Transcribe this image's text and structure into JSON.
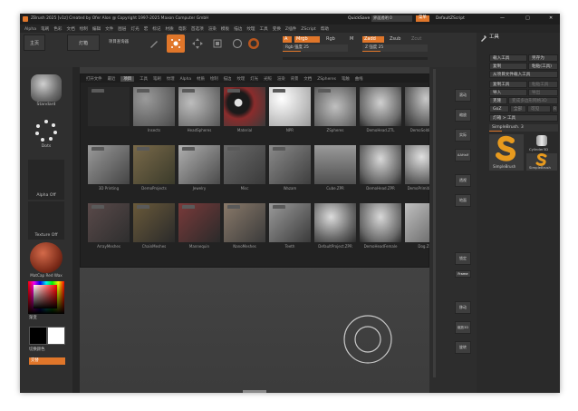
{
  "window": {
    "title": "ZBrush 2025 [v1z] Created by Ofer Alon @ Copyright 1997-2025 Maxon Computer GmbH",
    "autosave": "QuickSave",
    "transparency": "界面透明 0",
    "menus_label": "菜单",
    "script": "DefaultZScript",
    "win_controls": [
      "—",
      "□",
      "✕"
    ]
  },
  "menubar": {
    "items": [
      "Alpha",
      "笔刷",
      "色彩",
      "文档",
      "绘制",
      "编辑",
      "文件",
      "图层",
      "灯光",
      "宏",
      "标记",
      "材质",
      "电影",
      "首选项",
      "渲染",
      "模板",
      "描边",
      "纹理",
      "工具",
      "变换",
      "Z插件",
      "ZScript",
      "帮助"
    ]
  },
  "toolbar": {
    "home": "主页",
    "lightbox": "灯箱",
    "project_menu": "项目查询器",
    "tools": [
      {
        "name": "edit",
        "label": "Edit"
      },
      {
        "name": "draw",
        "label": "Draw"
      },
      {
        "name": "move",
        "label": "Move"
      },
      {
        "name": "scale",
        "label": "Scale"
      },
      {
        "name": "rotate",
        "label": "Rotate"
      }
    ],
    "a_label": "A",
    "mrgb": "Mrgb",
    "rgb": "Rgb",
    "m": "M",
    "zadd": "Zadd",
    "zsub": "Zsub",
    "zcut": "Zcut",
    "rgb_intensity": "Rgb 强度 25",
    "z_intensity": "Z 强度 25"
  },
  "left_shelf": {
    "brush": "Standard",
    "stroke": "Dots",
    "alpha": "Alpha Off",
    "texture": "Texture Off",
    "material": "MatCap Red Wax",
    "gradient": "渐变",
    "switch_color": "切换颜色",
    "alternate": "交替"
  },
  "lightbox": {
    "tabs": [
      "打开文件",
      "最近",
      "项目",
      "工具",
      "笔刷",
      "纹理",
      "Alpha",
      "材质",
      "绘制",
      "描边",
      "纹理",
      "灯光",
      "光照",
      "渲染",
      "背景",
      "文档",
      "ZSpheres",
      "笔触",
      "曲线"
    ],
    "active_tab": 2,
    "tiles": [
      {
        "label": ""
      },
      {
        "label": "Insects"
      },
      {
        "label": "HeadSpheres"
      },
      {
        "label": "Material"
      },
      {
        "label": "NPR"
      },
      {
        "label": "ZSpheres"
      },
      {
        "label": "DemoHead.ZTL"
      },
      {
        "label": "DemoSoldier.ZPR"
      },
      {
        "label": "3D Printing"
      },
      {
        "label": "DemoProjects"
      },
      {
        "label": "Jewelry"
      },
      {
        "label": "Misc"
      },
      {
        "label": "Wazam"
      },
      {
        "label": "Cube.ZPR"
      },
      {
        "label": "DemoHead.ZPR"
      },
      {
        "label": "DemoPrimitives.ZPR"
      },
      {
        "label": "ArrayMeshes"
      },
      {
        "label": "ChainMeshes"
      },
      {
        "label": "Mannequin"
      },
      {
        "label": "NanoMeshes"
      },
      {
        "label": "Teeth"
      },
      {
        "label": "DefaultProject.ZPR"
      },
      {
        "label": "DemoHeadFemale"
      },
      {
        "label": "Dog.ZPR"
      }
    ]
  },
  "right_shelf": {
    "scroll_label": "滚动",
    "zoom_label": "缩放",
    "actual_label": "实际",
    "aahalf_label": "AAHalf",
    "persp_label": "透视",
    "floor_label": "地面",
    "lock_label": "锁定",
    "frame_label": "Frame",
    "move_label": "移动",
    "zoom3d_label": "缩放3D",
    "rotate_label": "旋转"
  },
  "tool_palette": {
    "title": "工具",
    "load_tool": "载入工具",
    "save_as": "另存为",
    "copy": "复制",
    "paste": "粘贴(工具)",
    "import_from_project": "从项目文件载入工具",
    "copy_tool": "复制工具",
    "paste_tool": "粘贴工具",
    "import": "导入",
    "export": "导出",
    "clone": "克隆",
    "make_polymesh": "变成多边形网格3D",
    "goz": "GoZ",
    "all": "全部",
    "visible": "可见",
    "r": "R",
    "lightbox_tools": "灯箱 > 工具",
    "current_tool": "SimpleBrush. 3",
    "tools": [
      {
        "name": "SimpleBrush"
      },
      {
        "name": "Cylinder3D"
      },
      {
        "name": "SimpleBrush"
      }
    ]
  },
  "colors": {
    "accent": "#e0762a",
    "panel": "#2b2b2b",
    "dark": "#1e1e1e"
  }
}
